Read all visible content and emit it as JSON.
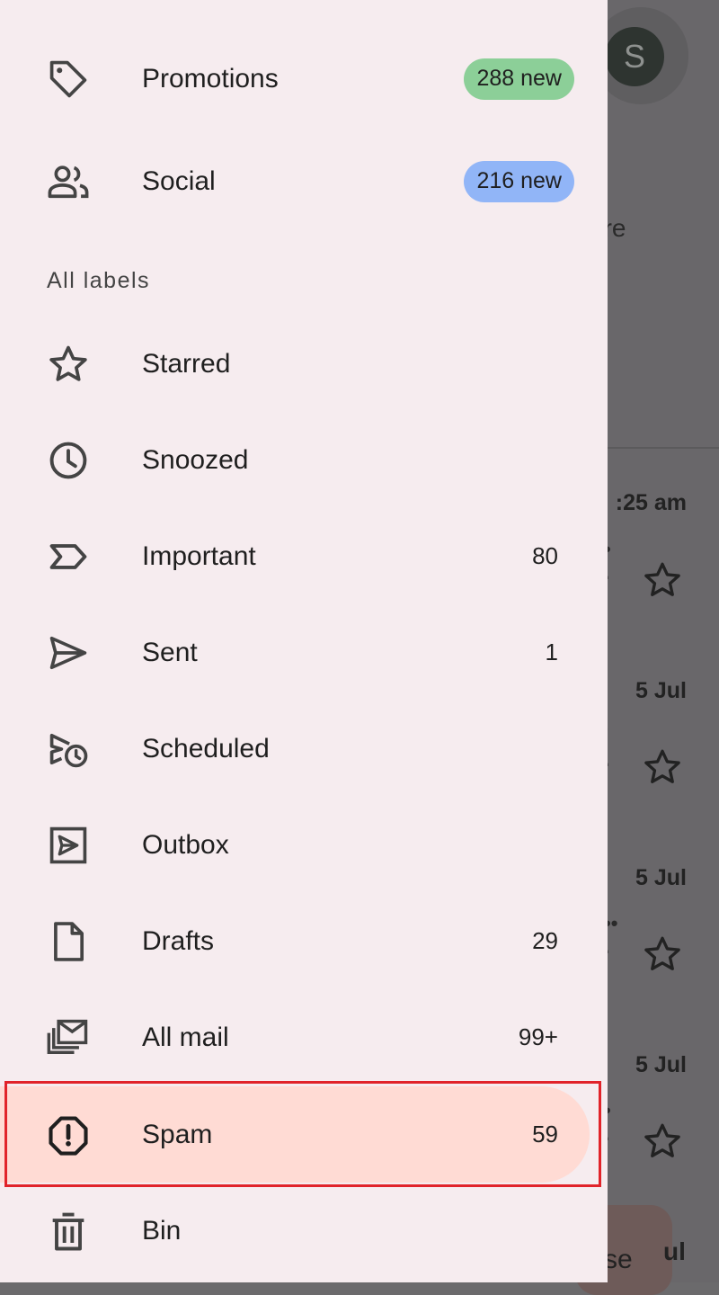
{
  "background": {
    "avatar_letter": "S",
    "peek_text": "ore",
    "times": [
      ":25 am",
      "5 Jul",
      "5 Jul",
      "5 Jul"
    ],
    "clipped_bottom_text": "se",
    "clipped_bottom_right": "ul"
  },
  "drawer": {
    "categories": [
      {
        "label": "Promotions",
        "icon": "tag-icon",
        "badge": "288 new",
        "badge_color": "#8ccf98"
      },
      {
        "label": "Social",
        "icon": "people-icon",
        "badge": "216 new",
        "badge_color": "#91b5f7"
      }
    ],
    "section_title": "All labels",
    "labels": [
      {
        "label": "Starred",
        "icon": "star-icon",
        "count": ""
      },
      {
        "label": "Snoozed",
        "icon": "clock-icon",
        "count": ""
      },
      {
        "label": "Important",
        "icon": "important-icon",
        "count": "80"
      },
      {
        "label": "Sent",
        "icon": "send-icon",
        "count": "1"
      },
      {
        "label": "Scheduled",
        "icon": "scheduled-send-icon",
        "count": ""
      },
      {
        "label": "Outbox",
        "icon": "outbox-icon",
        "count": ""
      },
      {
        "label": "Drafts",
        "icon": "draft-icon",
        "count": "29"
      },
      {
        "label": "All mail",
        "icon": "all-mail-icon",
        "count": "99+"
      },
      {
        "label": "Spam",
        "icon": "spam-icon",
        "count": "59",
        "selected": true
      },
      {
        "label": "Bin",
        "icon": "bin-icon",
        "count": ""
      }
    ]
  },
  "colors": {
    "drawer_bg": "#f6ecef",
    "selected_bg": "#ffdbd4",
    "highlight_border": "#e1232a",
    "scrim": "#69676a"
  }
}
